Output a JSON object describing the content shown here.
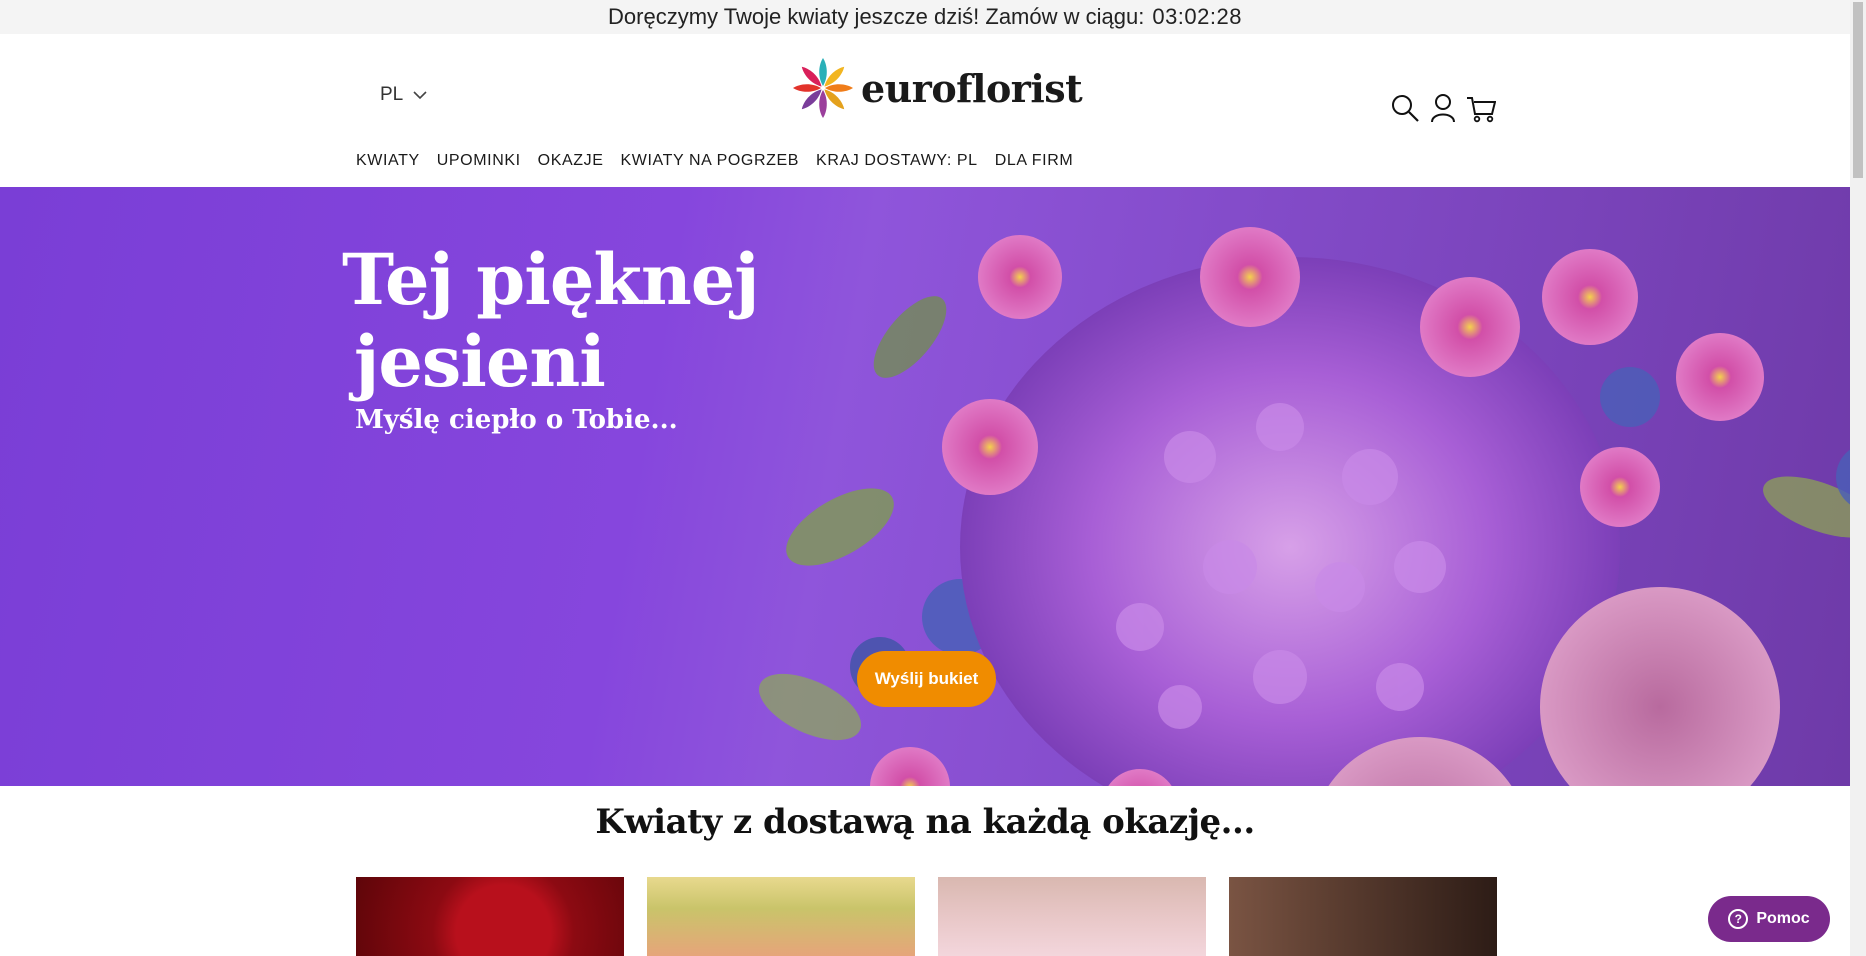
{
  "announcement": {
    "text": "Doręczymy Twoje kwiaty jeszcze dziś! Zamów w ciągu:",
    "countdown": "03:02:28"
  },
  "header": {
    "language": "PL",
    "brand": "euroflorist",
    "icons": [
      "search-icon",
      "user-icon",
      "cart-icon"
    ],
    "nav": [
      "KWIATY",
      "UPOMINKI",
      "OKAZJE",
      "KWIATY NA POGRZEB",
      "KRAJ DOSTAWY: PL",
      "DLA FIRM"
    ]
  },
  "hero": {
    "title_line1": "Tej pięknej",
    "title_line2": "jesieni",
    "subtitle": "Myślę ciepło o Tobie...",
    "cta": "Wyślij bukiet",
    "background_color": "#8646dd",
    "cta_color": "#f08c00"
  },
  "section": {
    "title": "Kwiaty z dostawą na każdą okazję..."
  },
  "help_widget": {
    "label": "Pomoc",
    "color": "#7a2a8c"
  }
}
